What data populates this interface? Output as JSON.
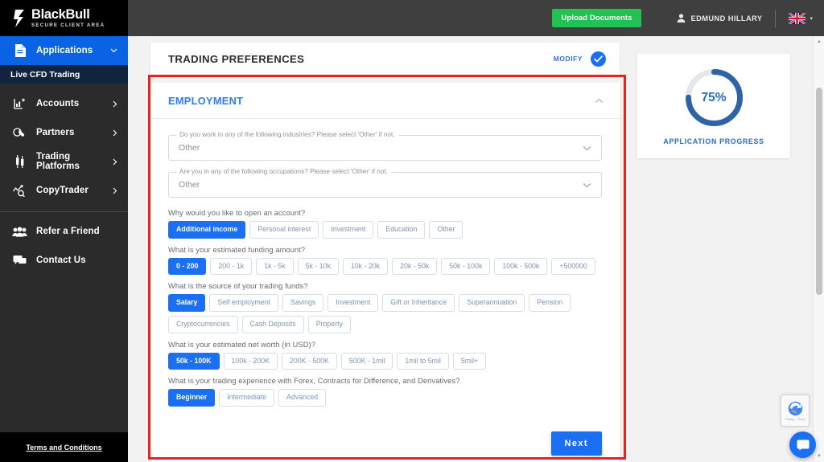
{
  "brand": {
    "name": "BlackBull",
    "tagline": "SECURE CLIENT AREA",
    "logo_icon": "blackbull-logo-icon"
  },
  "sidebar": {
    "items": [
      {
        "label": "Applications",
        "icon": "document-icon",
        "caret": "chevron-down-icon",
        "active": true
      },
      {
        "label": "Accounts",
        "icon": "chart-plus-icon",
        "caret": "chevron-right-icon",
        "active": false
      },
      {
        "label": "Partners",
        "icon": "handshake-icon",
        "caret": "chevron-right-icon",
        "active": false
      },
      {
        "label": "Trading Platforms",
        "icon": "candlestick-icon",
        "caret": "chevron-right-icon",
        "active": false
      },
      {
        "label": "CopyTrader",
        "icon": "trend-search-icon",
        "caret": "chevron-right-icon",
        "active": false
      },
      {
        "label": "Refer a Friend",
        "icon": "people-icon",
        "caret": "",
        "active": false
      },
      {
        "label": "Contact Us",
        "icon": "chat-icon",
        "caret": "",
        "active": false
      }
    ],
    "subnav": {
      "label": "Live CFD Trading"
    },
    "footer_link": "Terms and Conditions"
  },
  "topbar": {
    "upload_label": "Upload Documents",
    "user_name": "EDMUND HILLARY",
    "user_icon": "user-icon",
    "flag_icon": "uk-flag-icon",
    "flag_caret": "chevron-down-icon"
  },
  "preferences": {
    "title": "TRADING PREFERENCES",
    "modify_label": "MODIFY",
    "check_icon": "check-circle-icon"
  },
  "employment": {
    "title": "EMPLOYMENT",
    "collapse_icon": "chevron-up-icon",
    "selects": [
      {
        "legend": "Do you work in any of the following industries? Please select 'Other' if not.",
        "value": "Other",
        "caret": "chevron-down-icon"
      },
      {
        "legend": "Are you in any of the following occupations? Please select 'Other' if not.",
        "value": "Other",
        "caret": "chevron-down-icon"
      }
    ],
    "questions": [
      {
        "label": "Why would you like to open an account?",
        "options": [
          "Additional income",
          "Personal interest",
          "Investment",
          "Education",
          "Other"
        ],
        "selected": "Additional income"
      },
      {
        "label": "What is your estimated funding amount?",
        "options": [
          "0 - 200",
          "200 - 1k",
          "1k - 5k",
          "5k - 10k",
          "10k - 20k",
          "20k - 50k",
          "50k - 100k",
          "100k - 500k",
          "+500000"
        ],
        "selected": "0 - 200"
      },
      {
        "label": "What is the source of your trading funds?",
        "options": [
          "Salary",
          "Self employment",
          "Savings",
          "Investment",
          "Gift or Inheritance",
          "Superannuation",
          "Pension",
          "Cryptocurrencies",
          "Cash Deposits",
          "Property"
        ],
        "selected": "Salary"
      },
      {
        "label": "What is your estimated net worth (in USD)?",
        "options": [
          "50k - 100K",
          "100k - 200K",
          "200K - 500K",
          "500K - 1mil",
          "1mil to 5mil",
          "5mil+"
        ],
        "selected": "50k - 100K"
      },
      {
        "label": "What is your trading experience with Forex, Contracts for Difference, and Derivatives?",
        "options": [
          "Beginner",
          "Intermediate",
          "Advanced"
        ],
        "selected": "Beginner"
      }
    ],
    "next_label": "Next"
  },
  "progress": {
    "percent_label": "75%",
    "percent_value": 75,
    "caption": "APPLICATION PROGRESS",
    "ring_color": "#2f63a8",
    "track_color": "#e4e6e9"
  },
  "widgets": {
    "recaptcha_text": "Privacy - Terms",
    "recaptcha_icon": "recaptcha-icon",
    "chat_icon": "chat-bubble-icon"
  },
  "colors": {
    "accent_blue": "#1a6ff2",
    "sidebar_bg": "#2b2b2b",
    "topbar_bg": "#3f3f3f",
    "upload_green": "#21c154",
    "annotation_red": "#e8231f"
  }
}
